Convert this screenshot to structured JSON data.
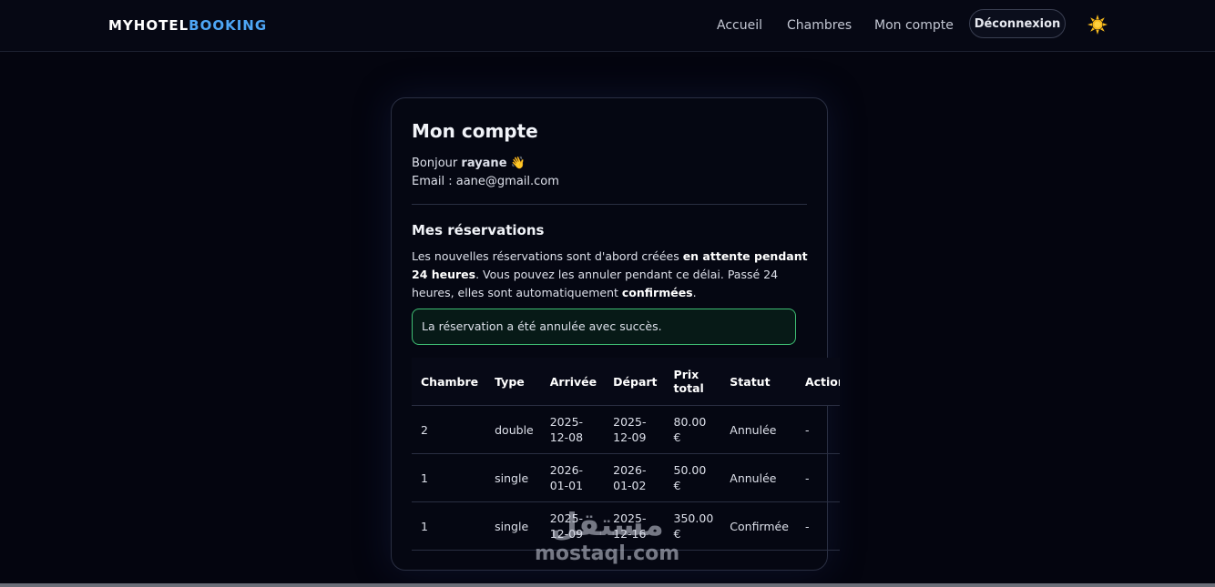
{
  "header": {
    "brand_part1": "MYHOTEL",
    "brand_part2": "BOOKING",
    "nav": [
      "Accueil",
      "Chambres",
      "Mon compte"
    ],
    "logout_label": "Déconnexion",
    "theme_icon": "sun-icon"
  },
  "account": {
    "title": "Mon compte",
    "greeting_prefix": "Bonjour",
    "username": "rayane",
    "wave_emoji": "👋",
    "email_label": "Email :",
    "email_value": "aane@gmail.com"
  },
  "reservations": {
    "title": "Mes réservations",
    "info_1": "Les nouvelles réservations sont d'abord créées ",
    "info_2": "en attente pendant 24 heures",
    "info_3": ". Vous pouvez les annuler pendant ce délai. Passé 24 heures, elles sont automatiquement ",
    "info_4": "confirmées",
    "info_5": ".",
    "alert": "La réservation a été annulée avec succès.",
    "headers": [
      "Chambre",
      "Type",
      "Arrivée",
      "Départ",
      "Prix total",
      "Statut",
      "Action"
    ],
    "rows": [
      [
        "2",
        "double",
        "2025-12-08",
        "2025-12-09",
        "80.00 €",
        "Annulée",
        "-"
      ],
      [
        "1",
        "single",
        "2026-01-01",
        "2026-01-02",
        "50.00 €",
        "Annulée",
        "-"
      ],
      [
        "1",
        "single",
        "2025-12-09",
        "2025-12-16",
        "350.00 €",
        "Confirmée",
        "-"
      ]
    ]
  },
  "watermark": {
    "arabic": "مستقل",
    "latin": "mostaql.com"
  },
  "colors": {
    "background": "#04050f",
    "brand_accent": "#4ea6f5",
    "alert_border": "#3fbf74"
  }
}
